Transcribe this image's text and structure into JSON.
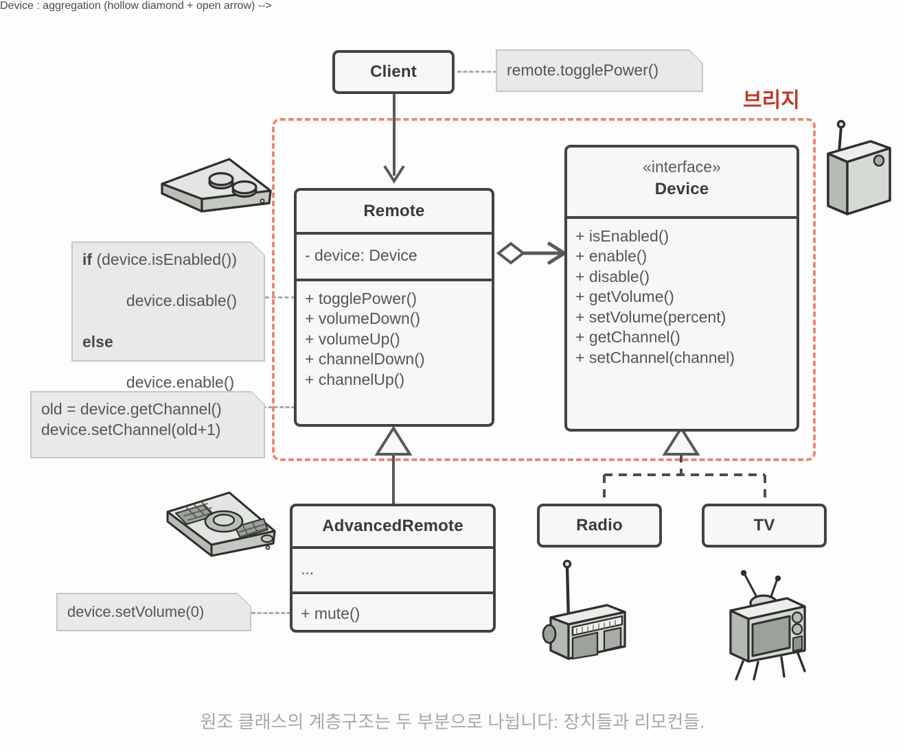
{
  "diagram": {
    "type": "uml-class-diagram",
    "pattern_label": "브리지",
    "caption": "원조 클래스의 계층구조는 두 부분으로 나뉩니다: 장치들과 리모컨들."
  },
  "colors": {
    "page_background": "#fdfdfd",
    "box_fill": "#f7f7f7",
    "box_stroke": "#434343",
    "note_fill": "#e9e9e9",
    "note_stroke": "#c6c6c6",
    "bridge_stroke": "#ef8871",
    "bridge_label": "#c0392b",
    "caption_text": "#a8a8a8",
    "connector": "#595959",
    "illustration_fill": "#d2d6d0",
    "illustration_stroke": "#333333"
  },
  "classes": {
    "client": {
      "name": "Client"
    },
    "remote": {
      "name": "Remote",
      "fields": [
        "- device: Device"
      ],
      "methods": [
        "+ togglePower()",
        "+ volumeDown()",
        "+ volumeUp()",
        "+ channelDown()",
        "+ channelUp()"
      ]
    },
    "device": {
      "stereotype": "«interface»",
      "name": "Device",
      "methods": [
        "+ isEnabled()",
        "+ enable()",
        "+ disable()",
        "+ getVolume()",
        "+ setVolume(percent)",
        "+ getChannel()",
        "+ setChannel(channel)"
      ]
    },
    "advanced_remote": {
      "name": "AdvancedRemote",
      "fields": [
        "..."
      ],
      "methods": [
        "+ mute()"
      ]
    },
    "radio": {
      "name": "Radio"
    },
    "tv": {
      "name": "TV"
    }
  },
  "notes": {
    "client_call": {
      "text": "remote.togglePower()"
    },
    "toggle_power": {
      "lines": [
        {
          "keyword": "if",
          "rest": " (device.isEnabled())"
        },
        {
          "keyword": "",
          "rest": "  device.disable()"
        },
        {
          "keyword": "else",
          "rest": ""
        },
        {
          "keyword": "",
          "rest": "  device.enable()"
        }
      ]
    },
    "channel_up": {
      "lines": [
        "old = device.getChannel()",
        "device.setChannel(old+1)"
      ]
    },
    "mute": {
      "text": "device.setVolume(0)"
    }
  },
  "illustrations": {
    "simple_remote": "simple-remote-illustration",
    "advanced_remote": "advanced-remote-illustration",
    "generic_device": "generic-device-illustration",
    "radio": "radio-illustration",
    "tv": "tv-illustration"
  }
}
